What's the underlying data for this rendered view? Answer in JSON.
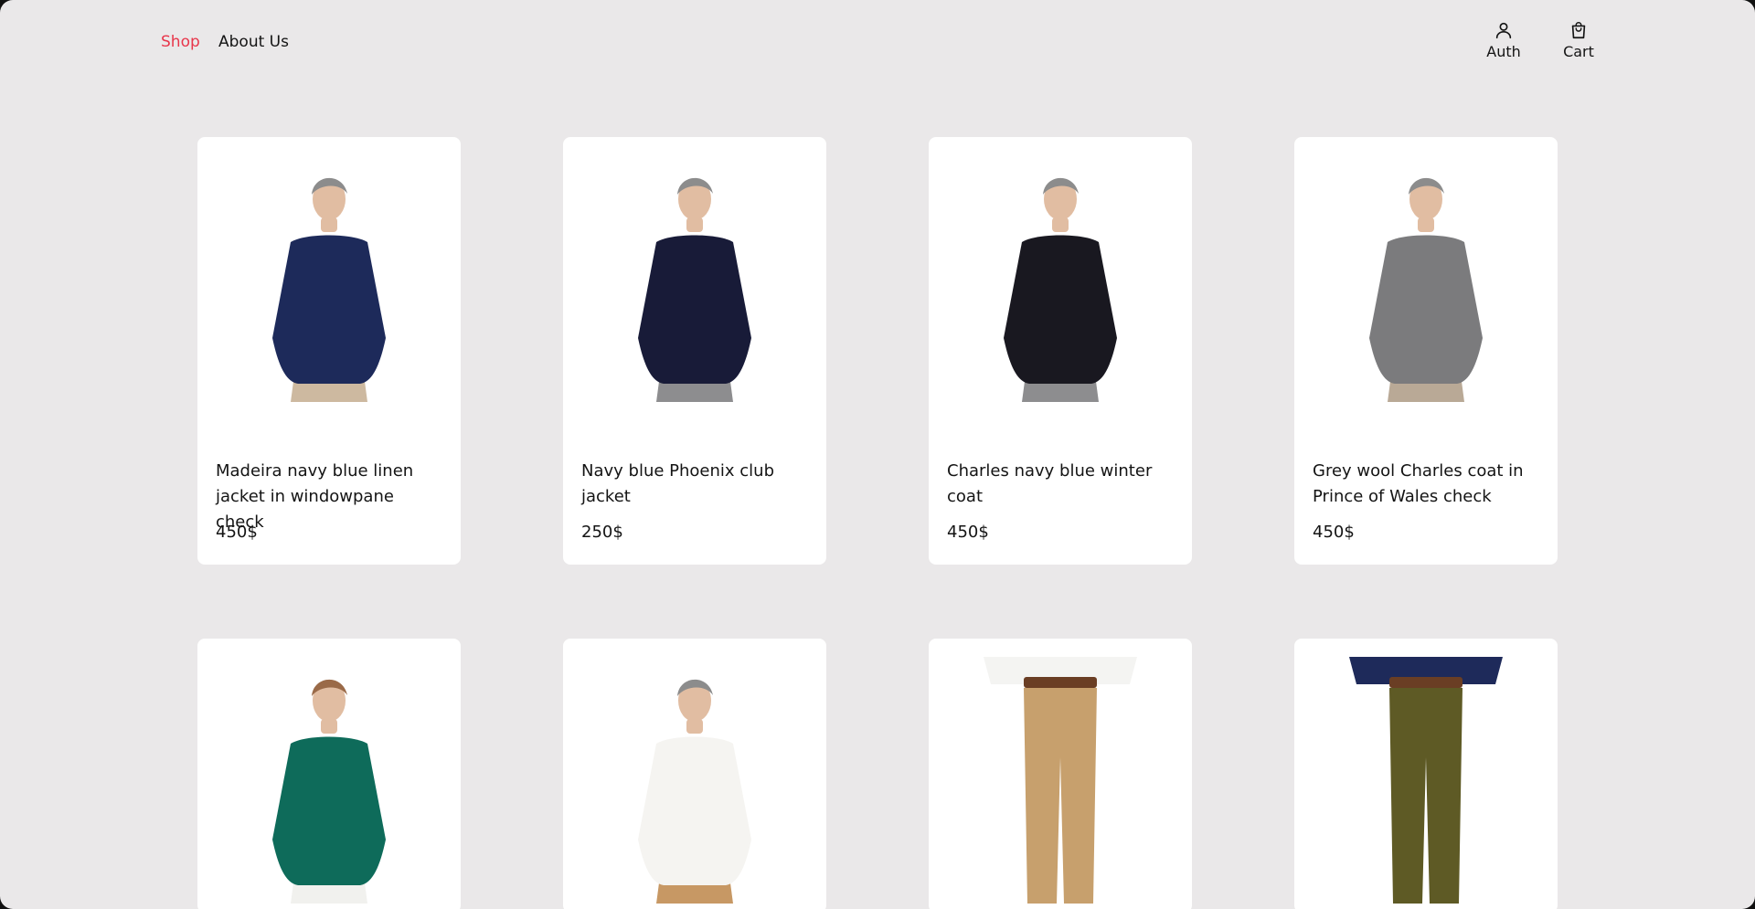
{
  "nav": {
    "shop_label": "Shop",
    "about_label": "About Us",
    "active_color": "#E8364B"
  },
  "actions": {
    "auth_label": "Auth",
    "cart_label": "Cart"
  },
  "colors": {
    "background": "#EAE8E9",
    "card": "#FFFFFF",
    "text": "#141414"
  },
  "products": [
    {
      "name": "Madeira navy blue linen jacket in windowpane check",
      "price": "450$",
      "garment": "navy jacket",
      "top_color": "#1D2A5A",
      "bottom_color": "#CDB9A0"
    },
    {
      "name": "Navy blue Phoenix club jacket",
      "price": "250$",
      "garment": "navy club jacket",
      "top_color": "#181B38",
      "bottom_color": "#8D8D8F"
    },
    {
      "name": "Charles navy blue winter coat",
      "price": "450$",
      "garment": "dark winter coat",
      "top_color": "#191820",
      "bottom_color": "#8D8D8F"
    },
    {
      "name": "Grey wool Charles coat in Prince of Wales check",
      "price": "450$",
      "garment": "grey check coat",
      "top_color": "#7B7B7D",
      "bottom_color": "#B9A996"
    },
    {
      "name": "",
      "price": "",
      "garment": "teal polo",
      "top_color": "#0E6B5A",
      "bottom_color": "#F1F1EE"
    },
    {
      "name": "",
      "price": "",
      "garment": "white polo",
      "top_color": "#F5F4F1",
      "bottom_color": "#C79864"
    },
    {
      "name": "",
      "price": "",
      "garment": "beige chinos",
      "top_color": "#F4F4F2",
      "bottom_color": "#C7A06D"
    },
    {
      "name": "",
      "price": "",
      "garment": "olive chinos",
      "top_color": "#1E2A5A",
      "bottom_color": "#5E5A25"
    }
  ]
}
